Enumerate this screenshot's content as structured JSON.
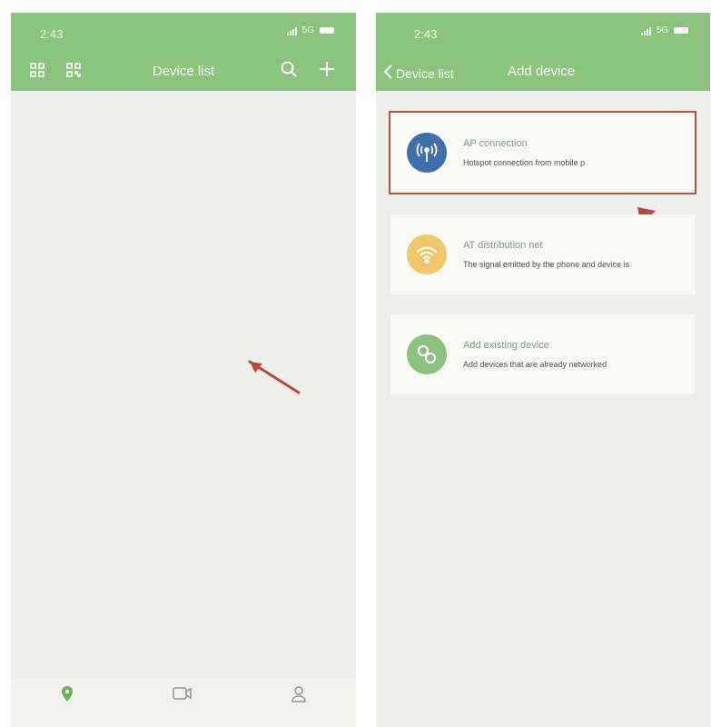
{
  "colors": {
    "accent": "#8cc47f",
    "highlight": "#c0503f",
    "screen_bg": "#eeeeec"
  },
  "left_screen": {
    "status": {
      "time": "2:43",
      "network": "5G"
    },
    "title": "Device list",
    "icons": [
      "grid-icon",
      "scan-icon",
      "search-icon",
      "plus-icon"
    ],
    "tabs": [
      {
        "icon": "device-icon",
        "label": ""
      },
      {
        "icon": "camera-icon",
        "label": ""
      },
      {
        "icon": "user-icon",
        "label": ""
      }
    ]
  },
  "right_screen": {
    "status": {
      "time": "2:43",
      "network": "5G"
    },
    "back_label": "Device list",
    "title": "Add device",
    "options": [
      {
        "icon": "antenna-icon",
        "title": "AP connection",
        "desc": "Hotspot connection from mobile p",
        "color": "#3f6ea8",
        "highlighted": true
      },
      {
        "icon": "wifi-icon",
        "title": "AT distribution net",
        "desc": "The signal emitted by the phone and device is",
        "color": "#f0c76a",
        "highlighted": false
      },
      {
        "icon": "link-icon",
        "title": "Add existing device",
        "desc": "Add devices that are already networked",
        "color": "#8dc17f",
        "highlighted": false
      }
    ]
  }
}
